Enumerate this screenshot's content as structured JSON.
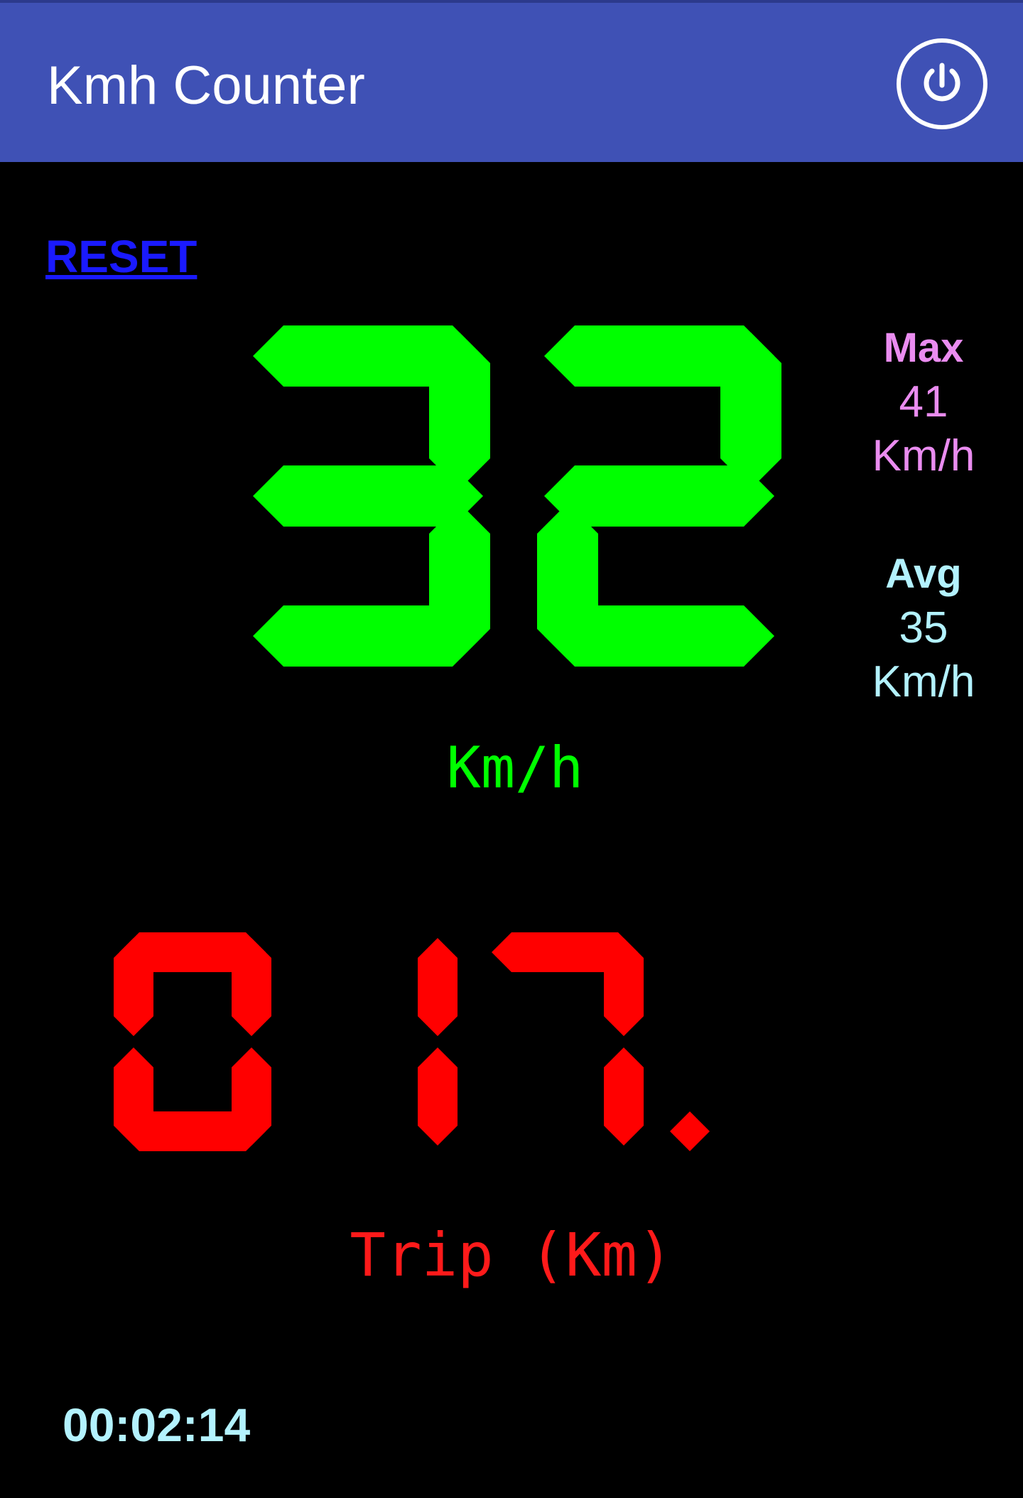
{
  "app": {
    "title": "Kmh Counter",
    "power_icon": "power-icon"
  },
  "controls": {
    "reset_label": "RESET"
  },
  "speed": {
    "value": "32",
    "unit": "Km/h",
    "color": "#00ff00"
  },
  "stats": {
    "max": {
      "label": "Max",
      "value": "41",
      "unit": "Km/h",
      "color": "#ea8cf0"
    },
    "avg": {
      "label": "Avg",
      "value": "35",
      "unit": "Km/h",
      "color": "#b3f2ff"
    }
  },
  "trip": {
    "value": "017.1",
    "label": "Trip (Km)",
    "color": "#ff0000"
  },
  "timer": {
    "elapsed": "00:02:14"
  },
  "colors": {
    "app_bar": "#3f51b5",
    "background": "#000000",
    "reset_link": "#1a1aff"
  }
}
